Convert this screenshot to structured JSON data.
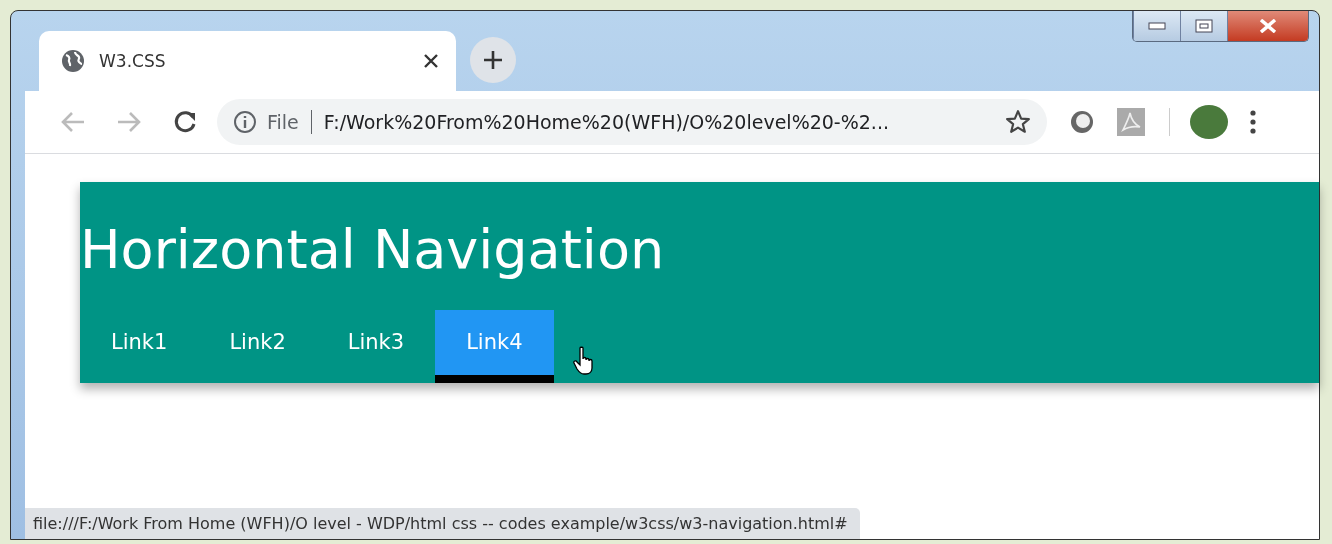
{
  "browser": {
    "tab": {
      "title": "W3.CSS"
    },
    "address": {
      "scheme": "File",
      "url": "F:/Work%20From%20Home%20(WFH)/O%20level%20-%2..."
    }
  },
  "page": {
    "heading": "Horizontal Navigation",
    "links": [
      {
        "label": "Link1",
        "selected": false
      },
      {
        "label": "Link2",
        "selected": false
      },
      {
        "label": "Link3",
        "selected": false
      },
      {
        "label": "Link4",
        "selected": true
      }
    ]
  },
  "status_bar": "file:///F:/Work From Home (WFH)/O level - WDP/html css -- codes example/w3css/w3-navigation.html#"
}
